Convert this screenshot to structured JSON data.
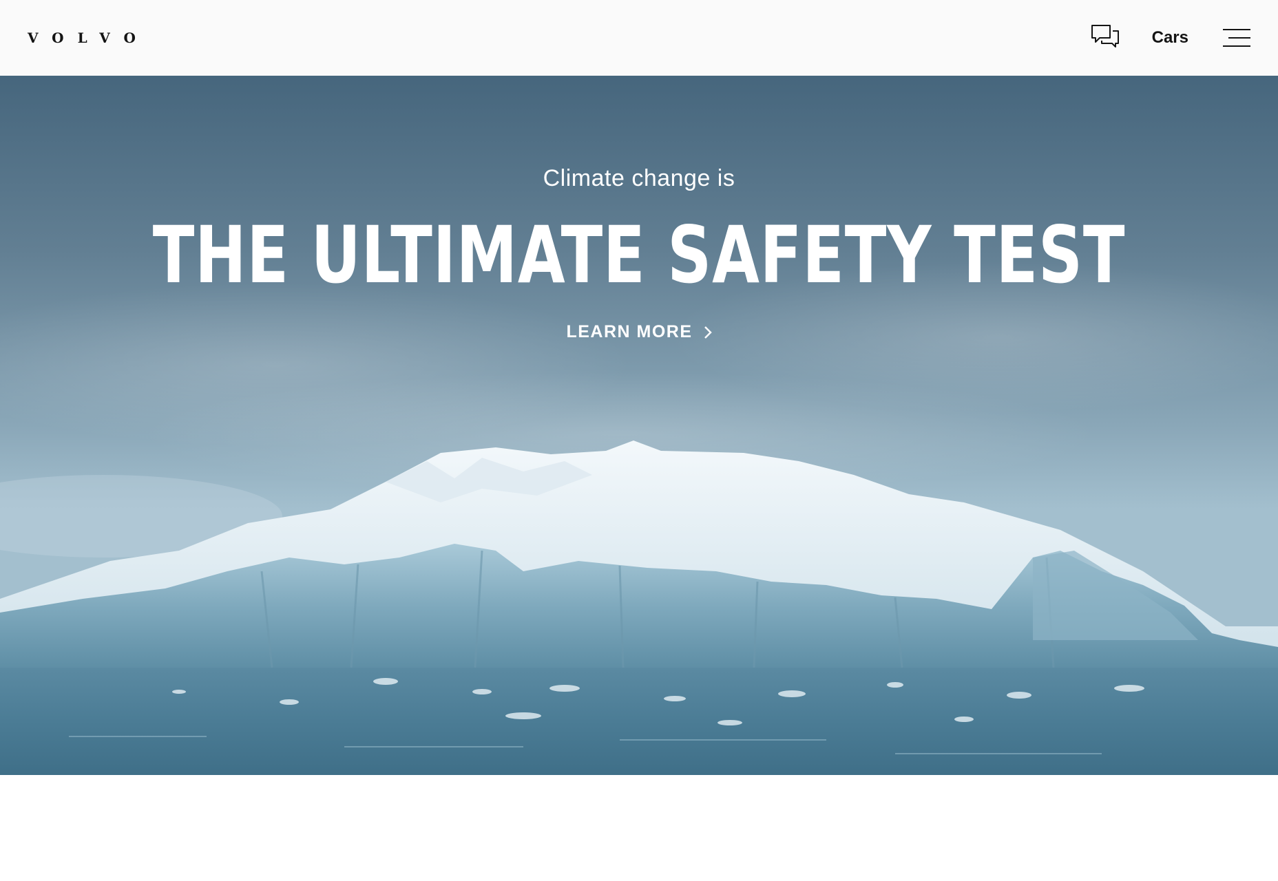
{
  "header": {
    "logo": "VOLVO",
    "chat_icon": "chat-bubbles-icon",
    "cars_label": "Cars",
    "menu_icon": "hamburger-menu-icon"
  },
  "hero": {
    "subtitle": "Climate change is",
    "title": "THE ULTIMATE SAFETY TEST",
    "cta_label": "LEARN MORE",
    "cta_icon": "chevron-right-icon",
    "image": "iceberg-photo"
  },
  "colors": {
    "header_bg": "#fafafa",
    "text_dark": "#141414",
    "hero_text": "#ffffff"
  }
}
